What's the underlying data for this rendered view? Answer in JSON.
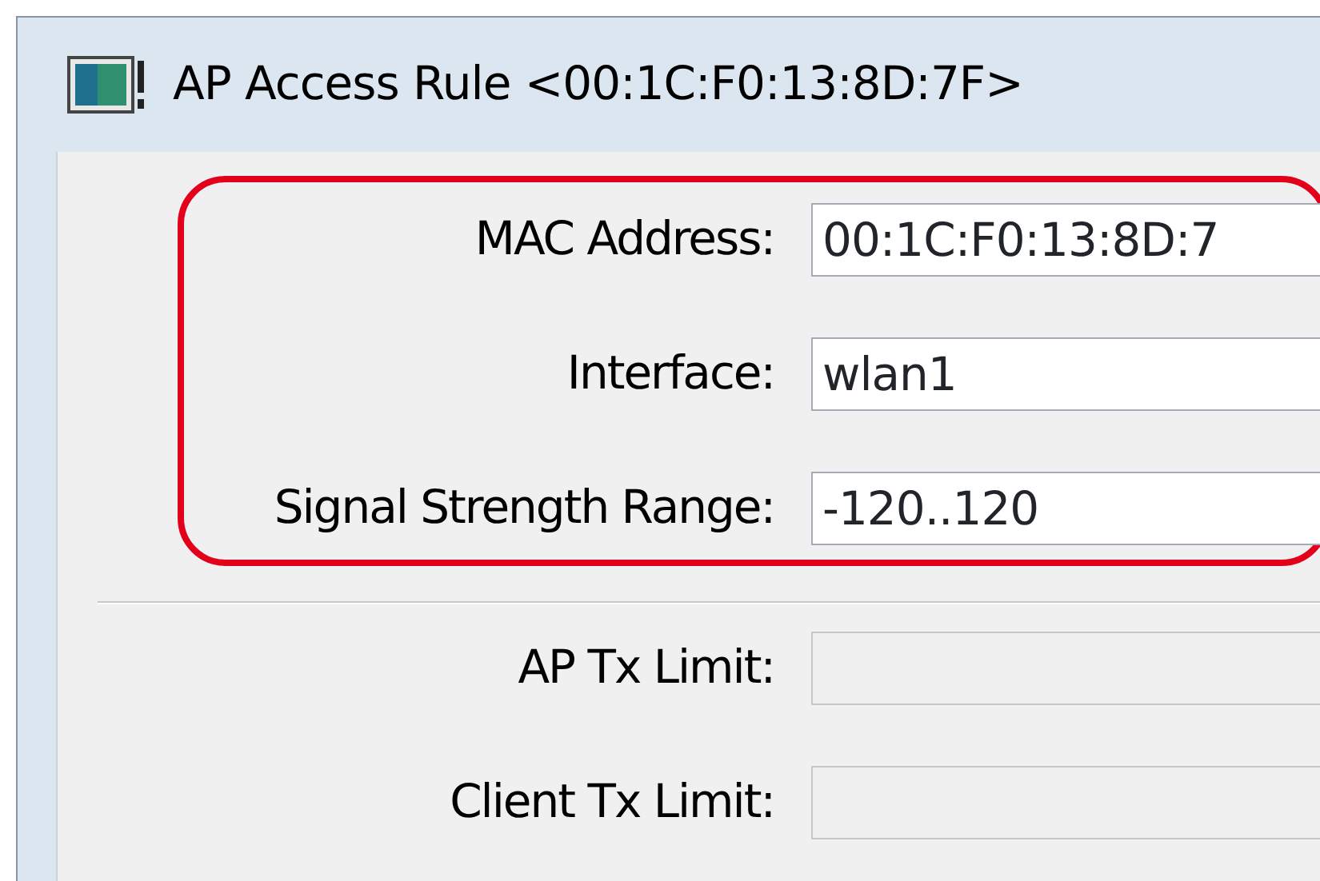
{
  "window": {
    "title": "AP Access Rule <00:1C:F0:13:8D:7F>"
  },
  "groups": [
    {
      "highlighted": true,
      "fields": [
        {
          "label": "MAC Address:",
          "value": "00:1C:F0:13:8D:7",
          "disabled": false
        },
        {
          "label": "Interface:",
          "value": "wlan1",
          "disabled": false
        },
        {
          "label": "Signal Strength Range:",
          "value": "-120..120",
          "disabled": false
        }
      ]
    },
    {
      "fields": [
        {
          "label": "AP Tx Limit:",
          "disabled": true
        },
        {
          "label": "Client Tx Limit:",
          "disabled": true
        }
      ]
    }
  ]
}
